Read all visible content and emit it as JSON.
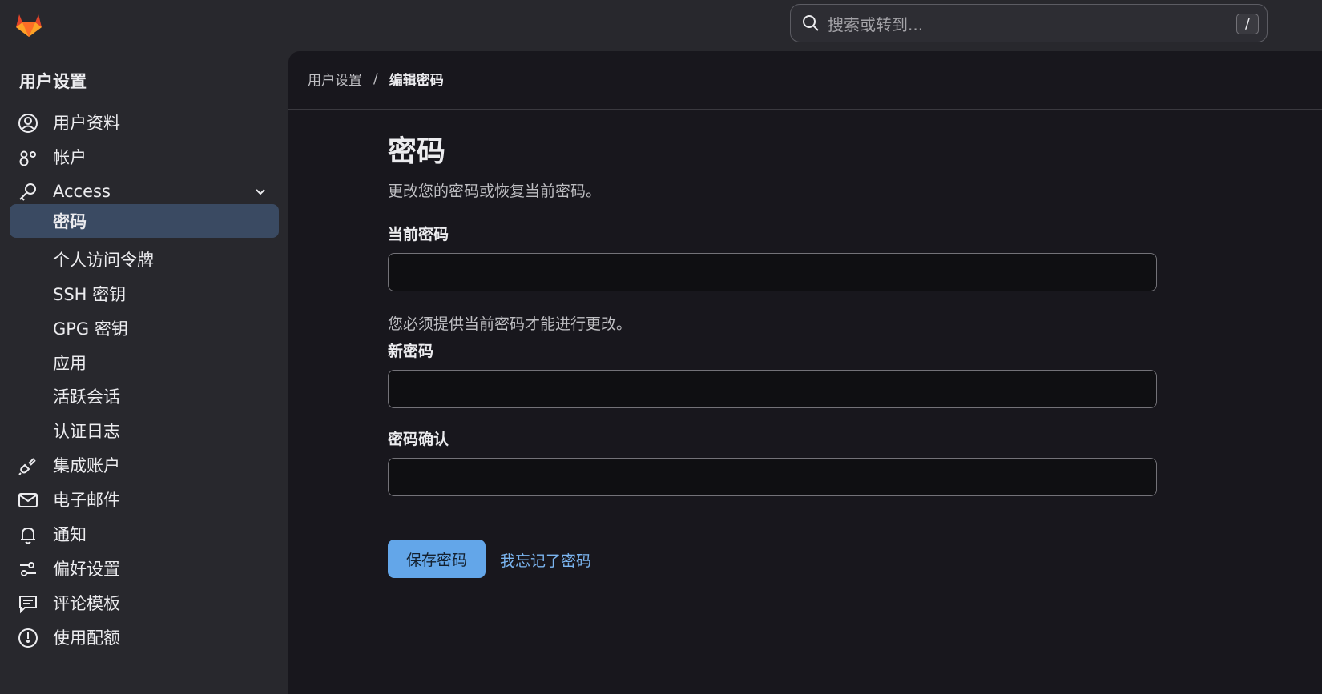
{
  "search": {
    "placeholder": "搜索或转到...",
    "shortcut": "/"
  },
  "sidebar": {
    "title": "用户设置",
    "items": [
      {
        "label": "用户资料",
        "icon": "profile-icon"
      },
      {
        "label": "帐户",
        "icon": "account-icon"
      },
      {
        "label": "Access",
        "icon": "key-icon",
        "expanded": true
      },
      {
        "label": "密码",
        "active": true
      },
      {
        "label": "个人访问令牌"
      },
      {
        "label": "SSH 密钥"
      },
      {
        "label": "GPG 密钥"
      },
      {
        "label": "应用"
      },
      {
        "label": "活跃会话"
      },
      {
        "label": "认证日志"
      },
      {
        "label": "集成账户",
        "icon": "plug-icon"
      },
      {
        "label": "电子邮件",
        "icon": "mail-icon"
      },
      {
        "label": "通知",
        "icon": "bell-icon"
      },
      {
        "label": "偏好设置",
        "icon": "preferences-icon"
      },
      {
        "label": "评论模板",
        "icon": "comment-icon"
      },
      {
        "label": "使用配额",
        "icon": "quota-icon"
      }
    ]
  },
  "breadcrumb": {
    "root": "用户设置",
    "separator": "/",
    "current": "编辑密码"
  },
  "page": {
    "title": "密码",
    "description": "更改您的密码或恢复当前密码。",
    "current_password_label": "当前密码",
    "current_password_value": "",
    "current_password_help": "您必须提供当前密码才能进行更改。",
    "new_password_label": "新密码",
    "new_password_value": "",
    "confirm_password_label": "密码确认",
    "confirm_password_value": "",
    "save_button": "保存密码",
    "forgot_link": "我忘记了密码"
  },
  "colors": {
    "accent": "#63a6e9",
    "link": "#7bb5f0",
    "active_bg": "#3a4a62",
    "logo": "#fc6d26"
  }
}
